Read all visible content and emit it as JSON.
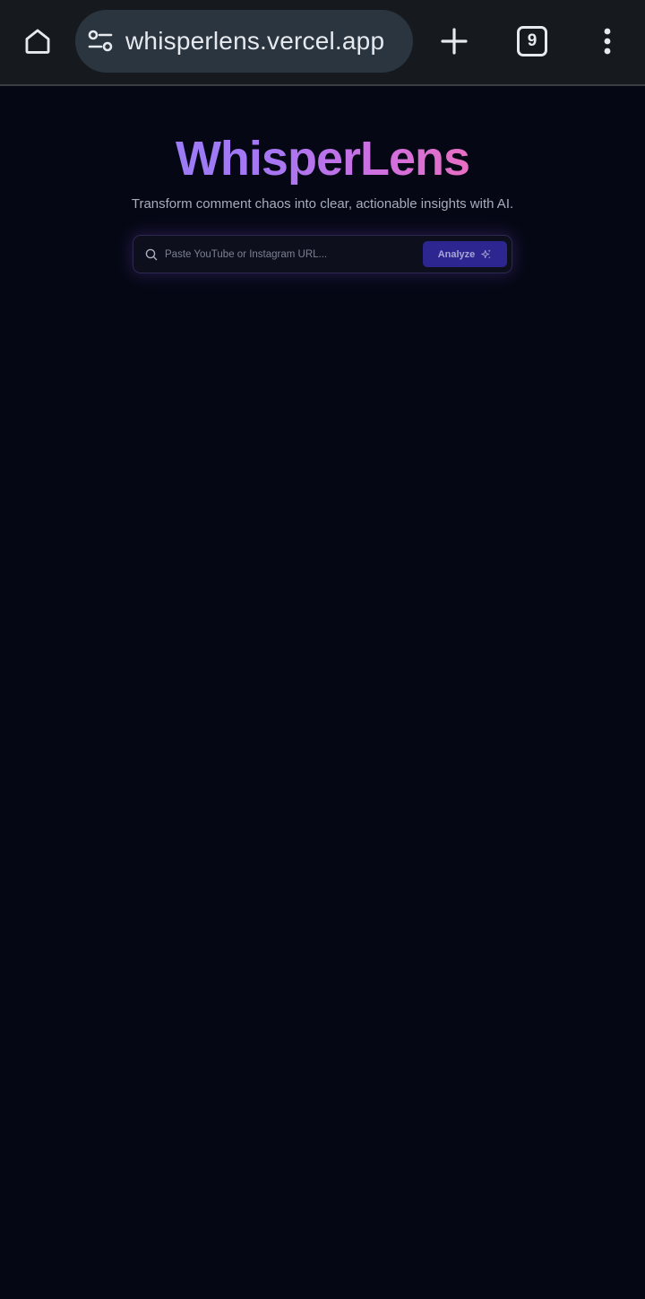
{
  "browser": {
    "url": "whisperlens.vercel.app",
    "tab_count": "9",
    "icons": {
      "home": "home-icon",
      "site_settings": "tune-icon",
      "new_tab": "plus-icon",
      "tabs": "tab-switcher-icon",
      "menu": "more-vert-icon"
    }
  },
  "hero": {
    "title": "WhisperLens",
    "subtitle": "Transform comment chaos into clear, actionable insights with AI."
  },
  "search": {
    "placeholder": "Paste YouTube or Instagram URL...",
    "value": "",
    "button_label": "Analyze",
    "icons": {
      "search": "search-icon",
      "button": "sparkle-icon"
    }
  },
  "colors": {
    "background": "#050814",
    "title_gradient_start": "#9b7bf7",
    "title_gradient_end": "#e86fc2",
    "button_bg": "#2d2690"
  }
}
